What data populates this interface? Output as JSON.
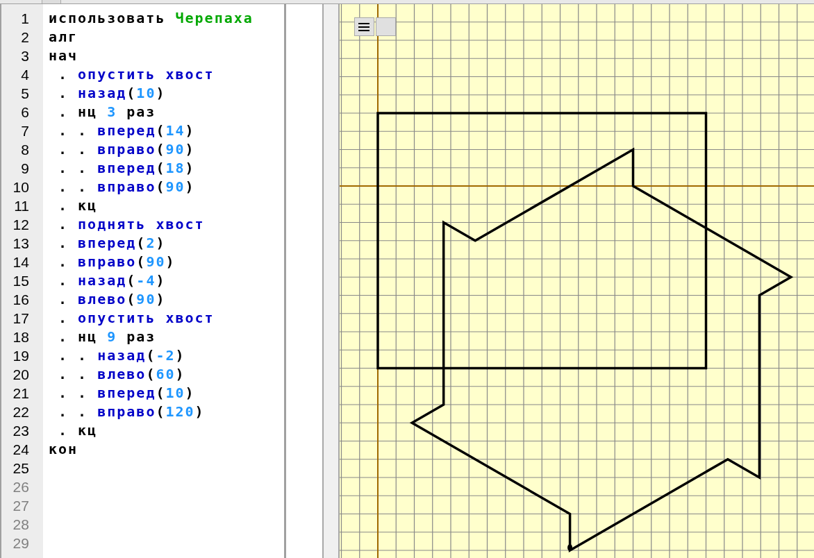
{
  "editor": {
    "lines": [
      {
        "number": "1",
        "dim": false,
        "tokens": [
          {
            "text": "использовать ",
            "kind": "keyword"
          },
          {
            "text": "Черепаха",
            "kind": "module"
          }
        ]
      },
      {
        "number": "2",
        "dim": false,
        "tokens": [
          {
            "text": "алг",
            "kind": "keyword"
          }
        ]
      },
      {
        "number": "3",
        "dim": false,
        "tokens": [
          {
            "text": "нач",
            "kind": "keyword"
          }
        ]
      },
      {
        "number": "4",
        "dim": false,
        "tokens": [
          {
            "text": " . ",
            "kind": "keyword"
          },
          {
            "text": "опустить хвост",
            "kind": "command"
          }
        ]
      },
      {
        "number": "5",
        "dim": false,
        "tokens": [
          {
            "text": " . ",
            "kind": "keyword"
          },
          {
            "text": "назад",
            "kind": "command"
          },
          {
            "text": "(",
            "kind": "keyword"
          },
          {
            "text": "10",
            "kind": "number"
          },
          {
            "text": ")",
            "kind": "keyword"
          }
        ]
      },
      {
        "number": "6",
        "dim": false,
        "tokens": [
          {
            "text": " . нц ",
            "kind": "keyword"
          },
          {
            "text": "3",
            "kind": "number"
          },
          {
            "text": " раз",
            "kind": "keyword"
          }
        ]
      },
      {
        "number": "7",
        "dim": false,
        "tokens": [
          {
            "text": " . . ",
            "kind": "keyword"
          },
          {
            "text": "вперед",
            "kind": "command"
          },
          {
            "text": "(",
            "kind": "keyword"
          },
          {
            "text": "14",
            "kind": "number"
          },
          {
            "text": ")",
            "kind": "keyword"
          }
        ]
      },
      {
        "number": "8",
        "dim": false,
        "tokens": [
          {
            "text": " . . ",
            "kind": "keyword"
          },
          {
            "text": "вправо",
            "kind": "command"
          },
          {
            "text": "(",
            "kind": "keyword"
          },
          {
            "text": "90",
            "kind": "number"
          },
          {
            "text": ")",
            "kind": "keyword"
          }
        ]
      },
      {
        "number": "9",
        "dim": false,
        "tokens": [
          {
            "text": " . . ",
            "kind": "keyword"
          },
          {
            "text": "вперед",
            "kind": "command"
          },
          {
            "text": "(",
            "kind": "keyword"
          },
          {
            "text": "18",
            "kind": "number"
          },
          {
            "text": ")",
            "kind": "keyword"
          }
        ]
      },
      {
        "number": "10",
        "dim": false,
        "tokens": [
          {
            "text": " . . ",
            "kind": "keyword"
          },
          {
            "text": "вправо",
            "kind": "command"
          },
          {
            "text": "(",
            "kind": "keyword"
          },
          {
            "text": "90",
            "kind": "number"
          },
          {
            "text": ")",
            "kind": "keyword"
          }
        ]
      },
      {
        "number": "11",
        "dim": false,
        "tokens": [
          {
            "text": " . кц",
            "kind": "keyword"
          }
        ]
      },
      {
        "number": "12",
        "dim": false,
        "tokens": [
          {
            "text": " . ",
            "kind": "keyword"
          },
          {
            "text": "поднять хвост",
            "kind": "command"
          }
        ]
      },
      {
        "number": "13",
        "dim": false,
        "tokens": [
          {
            "text": " . ",
            "kind": "keyword"
          },
          {
            "text": "вперед",
            "kind": "command"
          },
          {
            "text": "(",
            "kind": "keyword"
          },
          {
            "text": "2",
            "kind": "number"
          },
          {
            "text": ")",
            "kind": "keyword"
          }
        ]
      },
      {
        "number": "14",
        "dim": false,
        "tokens": [
          {
            "text": " . ",
            "kind": "keyword"
          },
          {
            "text": "вправо",
            "kind": "command"
          },
          {
            "text": "(",
            "kind": "keyword"
          },
          {
            "text": "90",
            "kind": "number"
          },
          {
            "text": ")",
            "kind": "keyword"
          }
        ]
      },
      {
        "number": "15",
        "dim": false,
        "tokens": [
          {
            "text": " . ",
            "kind": "keyword"
          },
          {
            "text": "назад",
            "kind": "command"
          },
          {
            "text": "(",
            "kind": "keyword"
          },
          {
            "text": "-4",
            "kind": "number"
          },
          {
            "text": ")",
            "kind": "keyword"
          }
        ]
      },
      {
        "number": "16",
        "dim": false,
        "tokens": [
          {
            "text": " . ",
            "kind": "keyword"
          },
          {
            "text": "влево",
            "kind": "command"
          },
          {
            "text": "(",
            "kind": "keyword"
          },
          {
            "text": "90",
            "kind": "number"
          },
          {
            "text": ")",
            "kind": "keyword"
          }
        ]
      },
      {
        "number": "17",
        "dim": false,
        "tokens": [
          {
            "text": " . ",
            "kind": "keyword"
          },
          {
            "text": "опустить хвост",
            "kind": "command"
          }
        ]
      },
      {
        "number": "18",
        "dim": false,
        "tokens": [
          {
            "text": " . нц ",
            "kind": "keyword"
          },
          {
            "text": "9",
            "kind": "number"
          },
          {
            "text": " раз",
            "kind": "keyword"
          }
        ]
      },
      {
        "number": "19",
        "dim": false,
        "tokens": [
          {
            "text": " . . ",
            "kind": "keyword"
          },
          {
            "text": "назад",
            "kind": "command"
          },
          {
            "text": "(",
            "kind": "keyword"
          },
          {
            "text": "-2",
            "kind": "number"
          },
          {
            "text": ")",
            "kind": "keyword"
          }
        ]
      },
      {
        "number": "20",
        "dim": false,
        "tokens": [
          {
            "text": " . . ",
            "kind": "keyword"
          },
          {
            "text": "влево",
            "kind": "command"
          },
          {
            "text": "(",
            "kind": "keyword"
          },
          {
            "text": "60",
            "kind": "number"
          },
          {
            "text": ")",
            "kind": "keyword"
          }
        ]
      },
      {
        "number": "21",
        "dim": false,
        "tokens": [
          {
            "text": " . . ",
            "kind": "keyword"
          },
          {
            "text": "вперед",
            "kind": "command"
          },
          {
            "text": "(",
            "kind": "keyword"
          },
          {
            "text": "10",
            "kind": "number"
          },
          {
            "text": ")",
            "kind": "keyword"
          }
        ]
      },
      {
        "number": "22",
        "dim": false,
        "tokens": [
          {
            "text": " . . ",
            "kind": "keyword"
          },
          {
            "text": "вправо",
            "kind": "command"
          },
          {
            "text": "(",
            "kind": "keyword"
          },
          {
            "text": "120",
            "kind": "number"
          },
          {
            "text": ")",
            "kind": "keyword"
          }
        ]
      },
      {
        "number": "23",
        "dim": false,
        "tokens": [
          {
            "text": " . кц",
            "kind": "keyword"
          }
        ]
      },
      {
        "number": "24",
        "dim": false,
        "tokens": [
          {
            "text": "кон",
            "kind": "keyword"
          }
        ]
      },
      {
        "number": "25",
        "dim": false
      },
      {
        "number": "26",
        "dim": true
      },
      {
        "number": "27",
        "dim": true
      },
      {
        "number": "28",
        "dim": true
      },
      {
        "number": "29",
        "dim": true
      }
    ]
  },
  "canvas": {
    "buttons": [
      {
        "kind": "menu"
      },
      {
        "kind": "blank"
      }
    ]
  }
}
